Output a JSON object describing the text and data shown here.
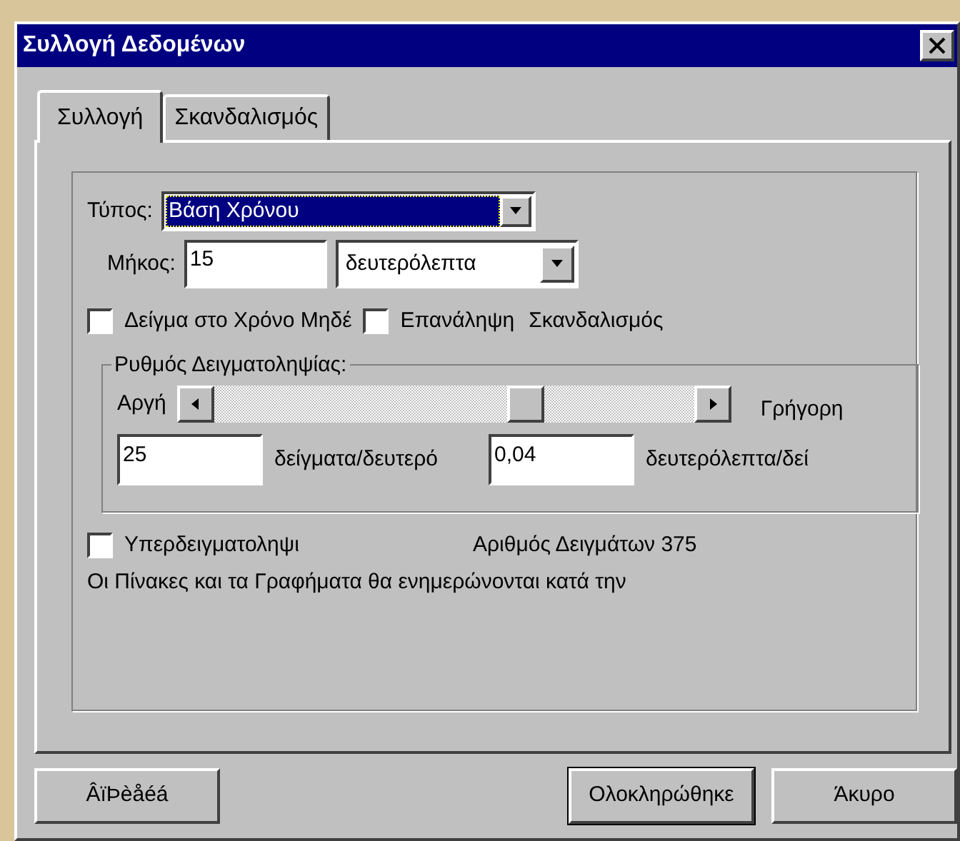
{
  "window": {
    "title": "Συλλογή Δεδομένων"
  },
  "tabs": [
    {
      "label": "Συλλογή",
      "selected": true
    },
    {
      "label": "Σκανδαλισμός",
      "selected": false
    }
  ],
  "type_field": {
    "label": "Τύπος:",
    "value": "Βάση Χρόνου"
  },
  "length_field": {
    "label": "Μήκος:",
    "value": "15",
    "unit": "δευτερόλεπτα"
  },
  "options": [
    {
      "label": "Δείγμα στο Χρόνο Μηδέ",
      "checked": false
    },
    {
      "label": "Επανάληψη",
      "checked": false
    }
  ],
  "options_note": "Σκανδαλισμός",
  "sampling_rate": {
    "title": "Ρυθμός Δειγματοληψίας:",
    "slow_label": "Αργή",
    "fast_label": "Γρήγορη",
    "level": 0.66,
    "rate_value": "25",
    "rate_unit": "δείγματα/δευτερό",
    "period_value": "0,04",
    "period_unit": "δευτερόλεπτα/δεί"
  },
  "oversampling": {
    "label": "Υπερδειγματοληψι",
    "checked": false
  },
  "sample_count": "Αριθμός Δειγμάτων 375",
  "note": "Οι Πίνακες και τα Γραφήματα θα ενημερώνονται κατά την",
  "buttons": [
    {
      "label": "ÂïÞèåéá",
      "default": false
    },
    {
      "label": "Ολοκληρώθηκε",
      "default": true
    },
    {
      "label": "Άκυρο",
      "default": false
    }
  ]
}
